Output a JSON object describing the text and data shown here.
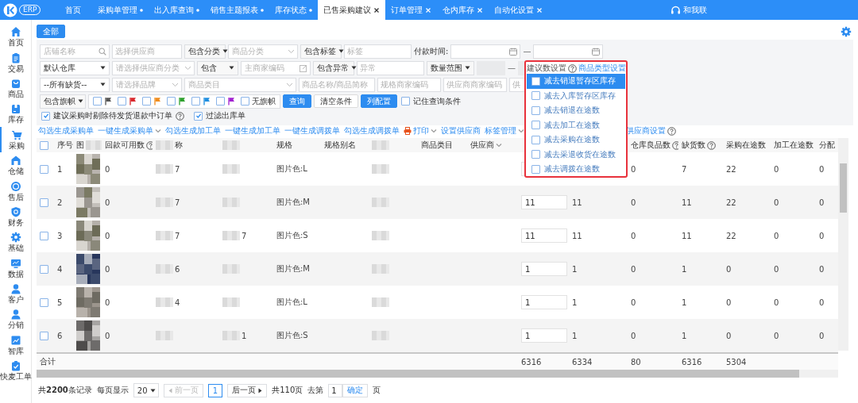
{
  "logo": {
    "text": "ERP"
  },
  "tabs": [
    {
      "label": "首页",
      "selected": false,
      "modified": false,
      "closable": false
    },
    {
      "label": "采购单管理",
      "selected": false,
      "modified": true,
      "closable": false
    },
    {
      "label": "出入库查询",
      "selected": false,
      "modified": true,
      "closable": false
    },
    {
      "label": "销售主题报表",
      "selected": false,
      "modified": true,
      "closable": false
    },
    {
      "label": "库存状态",
      "selected": false,
      "modified": true,
      "closable": false
    },
    {
      "label": "已售采购建议",
      "selected": true,
      "modified": false,
      "closable": true
    },
    {
      "label": "订单管理",
      "selected": false,
      "modified": false,
      "closable": true
    },
    {
      "label": "仓内库存",
      "selected": false,
      "modified": false,
      "closable": true
    },
    {
      "label": "自动化设置",
      "selected": false,
      "modified": false,
      "closable": true
    }
  ],
  "support": {
    "label": "和我联"
  },
  "sidebar": [
    {
      "label": "首页",
      "kind": "home",
      "selected": false
    },
    {
      "label": "交易",
      "kind": "clipboard",
      "selected": false
    },
    {
      "label": "商品",
      "kind": "bag",
      "selected": false
    },
    {
      "label": "库存",
      "kind": "box",
      "selected": false
    },
    {
      "label": "采购",
      "kind": "cart",
      "selected": true
    },
    {
      "label": "仓储",
      "kind": "house",
      "selected": false
    },
    {
      "label": "售后",
      "kind": "badge",
      "selected": false
    },
    {
      "label": "财务",
      "kind": "shield",
      "selected": false
    },
    {
      "label": "基础",
      "kind": "gear",
      "selected": false
    },
    {
      "label": "数据",
      "kind": "monitor",
      "selected": false
    },
    {
      "label": "客户",
      "kind": "person",
      "selected": false
    },
    {
      "label": "分销",
      "kind": "person",
      "selected": false
    },
    {
      "label": "智库",
      "kind": "chart",
      "selected": false
    },
    {
      "label": "快麦工单",
      "kind": "check",
      "selected": false
    }
  ],
  "scope_button": "全部",
  "filters": {
    "rows": [
      [
        {
          "kind": "search_input",
          "placeholder": "店铺名称"
        },
        {
          "kind": "input",
          "placeholder": "选择供应商"
        },
        {
          "kind": "select",
          "value": "包含分类"
        },
        {
          "kind": "picker_input",
          "placeholder": "商品分类"
        },
        {
          "kind": "select",
          "value": "包含标签"
        },
        {
          "kind": "input",
          "placeholder": "标签"
        },
        {
          "kind": "label",
          "text": "付款时间:"
        },
        {
          "kind": "date_input"
        },
        {
          "kind": "dash",
          "text": "—"
        },
        {
          "kind": "date_input"
        }
      ],
      [
        {
          "kind": "select",
          "value": "默认仓库"
        },
        {
          "kind": "picker_input",
          "placeholder": "请选择供应商分类"
        },
        {
          "kind": "select",
          "value": "包含"
        },
        {
          "kind": "edit_input",
          "placeholder": "主商家编码"
        },
        {
          "kind": "select",
          "value": "包含异常"
        },
        {
          "kind": "input",
          "placeholder": "异常"
        },
        {
          "kind": "select",
          "value": "数量范围"
        },
        {
          "kind": "blank"
        },
        {
          "kind": "dash",
          "text": "—"
        },
        {
          "kind": "blank"
        }
      ],
      [
        {
          "kind": "select",
          "value": "--所有缺货--"
        },
        {
          "kind": "picker_input",
          "placeholder": "请选择品牌"
        },
        {
          "kind": "picker_input",
          "placeholder": "商品类目"
        },
        {
          "kind": "input",
          "placeholder": "商品名称/商品简称"
        },
        {
          "kind": "input",
          "placeholder": "规格商家编码"
        },
        {
          "kind": "input",
          "placeholder": "供应商商家编码"
        },
        {
          "kind": "input",
          "placeholder": "供"
        }
      ],
      [
        {
          "kind": "select",
          "value": "包含旗帜"
        },
        {
          "kind": "flags",
          "flags": [
            {
              "color": "#555555",
              "checked": false
            },
            {
              "color": "#d9262b",
              "checked": false
            },
            {
              "color": "#f08c1c",
              "checked": false
            },
            {
              "color": "#2ca02c",
              "checked": false
            },
            {
              "color": "#1f8fe0",
              "checked": false
            },
            {
              "color": "#a020d0",
              "checked": false
            }
          ],
          "no_flag": {
            "label": "无旗帜",
            "checked": false
          }
        },
        {
          "kind": "button",
          "label": "查询",
          "primary": true
        },
        {
          "kind": "button",
          "label": "清空条件",
          "primary": false
        },
        {
          "kind": "button",
          "label": "列配置",
          "primary": true
        },
        {
          "kind": "checkbox",
          "label": "记住查询条件",
          "checked": false
        }
      ],
      [
        {
          "kind": "checkbox",
          "label": "建议采购时剔除待发货退款中订单",
          "checked": true,
          "help": true
        },
        {
          "kind": "checkbox",
          "label": "过滤出库单",
          "checked": true
        }
      ]
    ]
  },
  "actions": [
    {
      "kind": "link",
      "label": "勾选生成采购单"
    },
    {
      "kind": "link",
      "label": "一键生成采购单",
      "caret": true
    },
    {
      "kind": "link",
      "label": "勾选生成加工单"
    },
    {
      "kind": "link",
      "label": "一键生成加工单"
    },
    {
      "kind": "link",
      "label": "一键生成调拨单"
    },
    {
      "kind": "link",
      "label": "勾选生成调拨单"
    },
    {
      "kind": "print",
      "label": "打印",
      "caret": true
    },
    {
      "kind": "link",
      "label": "设置供应商"
    },
    {
      "kind": "link",
      "label": "标签管理",
      "caret": true
    },
    {
      "kind": "link",
      "label": "供应商设置",
      "help": true
    }
  ],
  "table": {
    "columns": [
      {
        "kind": "check",
        "checked": false
      },
      {
        "kind": "index",
        "label": "序号"
      },
      {
        "label": "图"
      },
      {
        "kind": "num",
        "label": "回款可用数",
        "help": true
      },
      {
        "kind": "masked",
        "label": "称"
      },
      {
        "kind": "masked"
      },
      {
        "kind": "text",
        "label": "规格"
      },
      {
        "kind": "text",
        "label": "规格别名"
      },
      {
        "kind": "masked"
      },
      {
        "kind": "text",
        "label": "商品类目"
      },
      {
        "kind": "text",
        "label": "供应商",
        "caret": true
      },
      {
        "kind": "input"
      },
      {
        "kind": "num"
      },
      {
        "kind": "num",
        "label": "仓库良品数",
        "help": true
      },
      {
        "kind": "num",
        "label": "缺货数",
        "help": true
      },
      {
        "kind": "num",
        "label": "采购在途数"
      },
      {
        "kind": "num",
        "label": "加工在途数"
      },
      {
        "kind": "num",
        "label": "分配"
      }
    ],
    "rows": [
      {
        "checked": false,
        "cells": [
          null,
          "1",
          null,
          "0",
          "7",
          null,
          "图片色:L",
          null,
          null,
          null,
          null,
          null,
          null,
          "0",
          "7",
          "22",
          "0",
          "0"
        ]
      },
      {
        "checked": false,
        "cells": [
          null,
          "2",
          null,
          "0",
          "7",
          null,
          "图片色:M",
          null,
          null,
          null,
          null,
          "11",
          "11",
          "0",
          "11",
          "22",
          "0",
          "0"
        ]
      },
      {
        "checked": false,
        "cells": [
          null,
          "3",
          null,
          "0",
          "7",
          "7",
          "图片色:S",
          null,
          null,
          null,
          null,
          "11",
          "11",
          "0",
          "11",
          "22",
          "0",
          "0"
        ]
      },
      {
        "checked": false,
        "cells": [
          null,
          "4",
          null,
          "0",
          "6",
          null,
          "图片色:M",
          null,
          null,
          null,
          null,
          "1",
          "1",
          "0",
          "1",
          "0",
          "0",
          "0"
        ]
      },
      {
        "checked": false,
        "cells": [
          null,
          "5",
          null,
          "0",
          "4",
          null,
          "图片色:L",
          null,
          null,
          null,
          null,
          "1",
          "1",
          "0",
          "1",
          "0",
          "0",
          "0"
        ]
      },
      {
        "checked": false,
        "cells": [
          null,
          "6",
          null,
          "0",
          null,
          "1",
          "图片色:S",
          null,
          null,
          null,
          null,
          "1",
          "1",
          "0",
          "1",
          "0",
          "0",
          "0"
        ]
      }
    ],
    "totals": {
      "label": "合计",
      "cells": [
        null,
        null,
        null,
        null,
        null,
        null,
        null,
        null,
        null,
        null,
        null,
        "6316",
        "6334",
        "80",
        "6316",
        "5304",
        null,
        null
      ]
    }
  },
  "popup": {
    "title": "建议数设置",
    "help": true,
    "link": "商品类型设置",
    "items": [
      {
        "label": "减去销退暂存区库存",
        "checked": false,
        "highlighted": true
      },
      {
        "label": "减去入库暂存区库存",
        "checked": false,
        "highlighted": false
      },
      {
        "label": "减去销退在途数",
        "checked": false,
        "highlighted": false
      },
      {
        "label": "减去加工在途数",
        "checked": false,
        "highlighted": false
      },
      {
        "label": "减去采购在途数",
        "checked": false,
        "highlighted": false
      },
      {
        "label": "减去采退收货在途数",
        "checked": false,
        "highlighted": false
      },
      {
        "label": "减去调拨在途数",
        "checked": false,
        "highlighted": false
      }
    ]
  },
  "pagination": {
    "total": "共**2200**条记录",
    "page_size_label": "每页显示",
    "page_size": "20",
    "prev": {
      "label": "前一页",
      "disabled": true
    },
    "pages": [
      {
        "label": "1",
        "selected": true
      }
    ],
    "next": {
      "label": "后一页",
      "disabled": false
    },
    "page_count": "共110页",
    "goto_label": "去第",
    "goto_value": "1",
    "confirm": "确定",
    "suffix": "页"
  }
}
